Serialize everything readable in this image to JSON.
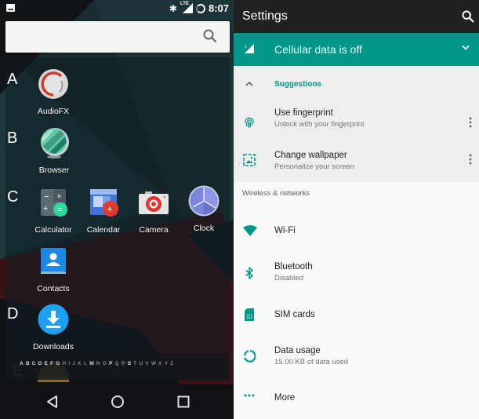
{
  "left_panel": {
    "status_bar": {
      "time": "8:07",
      "icons": [
        "image-notification-icon",
        "bluetooth-icon",
        "lte-signal-icon",
        "battery-icon"
      ],
      "lte_label": "LTE"
    },
    "search": {
      "placeholder": "",
      "icon": "search-icon"
    },
    "sections": [
      {
        "letter": "A",
        "apps": [
          {
            "label": "AudioFX",
            "icon": "audiofx-icon"
          }
        ]
      },
      {
        "letter": "B",
        "apps": [
          {
            "label": "Browser",
            "icon": "browser-icon"
          }
        ]
      },
      {
        "letter": "C",
        "apps": [
          {
            "label": "Calculator",
            "icon": "calculator-icon"
          },
          {
            "label": "Calendar",
            "icon": "calendar-icon"
          },
          {
            "label": "Camera",
            "icon": "camera-icon"
          },
          {
            "label": "Clock",
            "icon": "clock-icon"
          },
          {
            "label": "Contacts",
            "icon": "contacts-icon"
          }
        ]
      },
      {
        "letter": "D",
        "apps": [
          {
            "label": "Downloads",
            "icon": "downloads-icon"
          }
        ]
      },
      {
        "letter": "E",
        "apps": []
      }
    ],
    "alphabet": [
      "A",
      "B",
      "C",
      "D",
      "E",
      "F",
      "G",
      "H",
      "I",
      "J",
      "K",
      "L",
      "M",
      "N",
      "O",
      "P",
      "Q",
      "R",
      "S",
      "T",
      "U",
      "V",
      "W",
      "X",
      "Y",
      "Z"
    ],
    "alphabet_active": [
      "A",
      "B",
      "C",
      "D",
      "E",
      "F",
      "G",
      "M",
      "P",
      "S"
    ],
    "nav_bar": {
      "back": "back-icon",
      "home": "home-icon",
      "recents": "recents-icon"
    }
  },
  "right_panel": {
    "app_bar": {
      "title": "Settings",
      "search_icon": "search-icon"
    },
    "condition": {
      "text": "Cellular data is off",
      "icon": "cellular-off-icon",
      "expand_icon": "chevron-down-icon"
    },
    "suggestions": {
      "header": "Suggestions",
      "items": [
        {
          "title": "Use fingerprint",
          "summary": "Unlock with your fingerprint",
          "icon": "fingerprint-icon"
        },
        {
          "title": "Change wallpaper",
          "summary": "Personalize your screen",
          "icon": "wallpaper-icon"
        }
      ]
    },
    "category": "Wireless & networks",
    "items": [
      {
        "title": "Wi-Fi",
        "summary": "",
        "icon": "wifi-icon"
      },
      {
        "title": "Bluetooth",
        "summary": "Disabled",
        "icon": "bluetooth-icon"
      },
      {
        "title": "SIM cards",
        "summary": "",
        "icon": "sim-card-icon"
      },
      {
        "title": "Data usage",
        "summary": "15.00 KB of data used",
        "icon": "data-usage-icon"
      },
      {
        "title": "More",
        "summary": "",
        "icon": "more-horiz-icon"
      }
    ]
  },
  "colors": {
    "accent": "#009688",
    "appbar": "#212121",
    "suggestions_bg": "#eeeeee"
  }
}
